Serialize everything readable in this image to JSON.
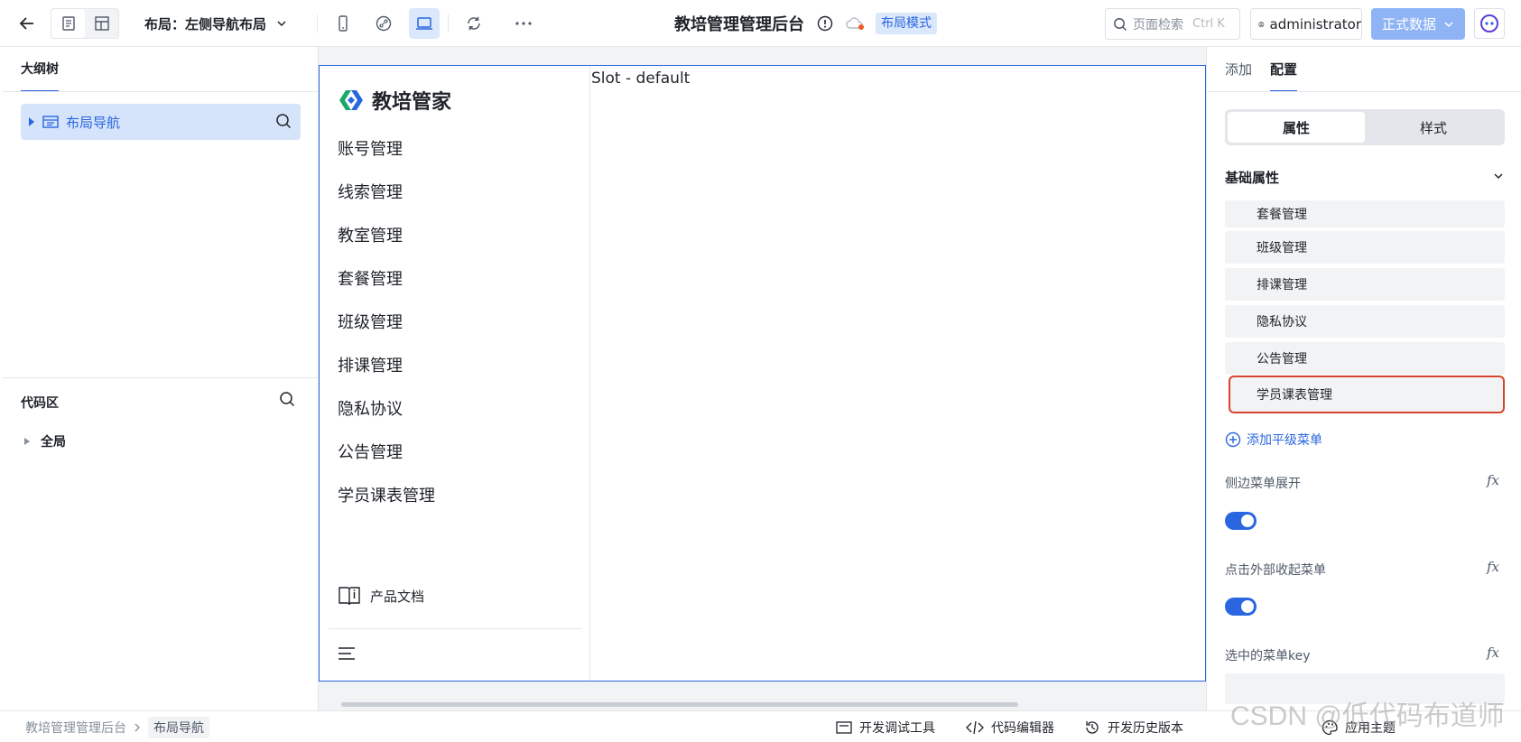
{
  "topbar": {
    "layout_label": "布局：左侧导航布局",
    "app_title": "教培管理管理后台",
    "mode_badge": "布局模式",
    "search_placeholder": "页面检索",
    "search_shortcut": "Ctrl K",
    "user_name": "administrator",
    "env_label": "正式数据"
  },
  "left_panel": {
    "tab": "大纲树",
    "tree_node": "布局导航",
    "code_title": "代码区",
    "code_node": "全局"
  },
  "canvas": {
    "brand": "教培管家",
    "menu": [
      "账号管理",
      "线索管理",
      "教室管理",
      "套餐管理",
      "班级管理",
      "排课管理",
      "隐私协议",
      "公告管理",
      "学员课表管理"
    ],
    "doc_link": "产品文档",
    "slot_label": "Slot - default"
  },
  "right_panel": {
    "tabs": [
      "添加",
      "配置"
    ],
    "segments": [
      "属性",
      "样式"
    ],
    "section_title": "基础属性",
    "items": [
      "套餐管理",
      "班级管理",
      "排课管理",
      "隐私协议",
      "公告管理",
      "学员课表管理"
    ],
    "add_menu": "添加平级菜单",
    "props": [
      "侧边菜单展开",
      "点击外部收起菜单",
      "选中的菜单key"
    ],
    "fx_label": "fx",
    "toggles": [
      true,
      true
    ]
  },
  "statusbar": {
    "breadcrumb": [
      "教培管理管理后台",
      "布局导航"
    ],
    "tools": [
      "开发调试工具",
      "代码编辑器",
      "开发历史版本",
      "应用主题"
    ],
    "watermark": "CSDN @低代码布道师"
  },
  "colors": {
    "accent": "#2966e0",
    "selected_border": "#d9442c",
    "env_button": "#8fb4f5"
  }
}
